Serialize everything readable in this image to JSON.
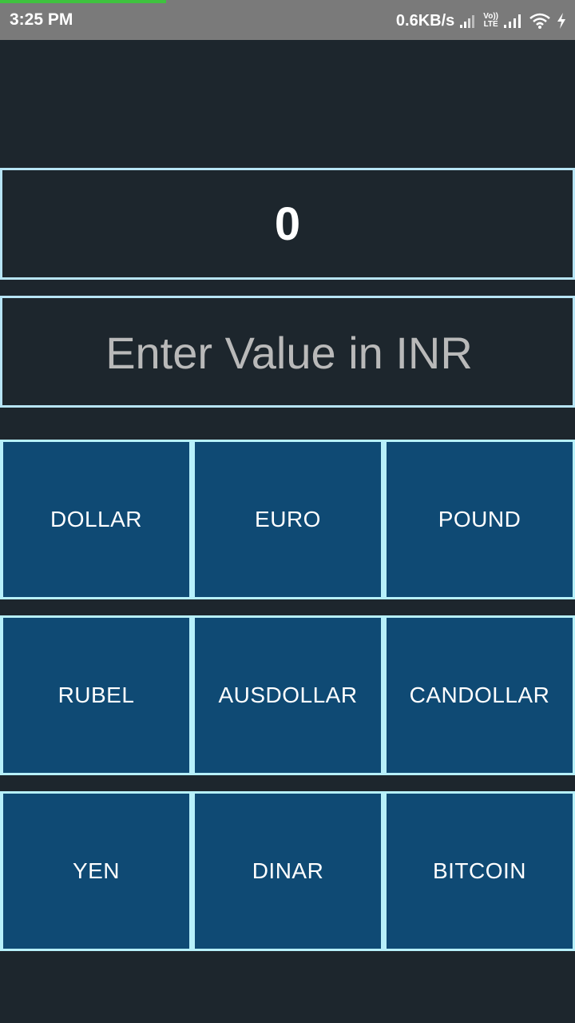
{
  "status_bar": {
    "time": "3:25 PM",
    "network_speed": "0.6KB/s",
    "volte_top": "Vo))",
    "volte_bottom": "LTE",
    "icons": [
      "signal-icon",
      "volte-icon",
      "signal-icon",
      "wifi-icon",
      "charging-icon"
    ]
  },
  "result": {
    "value": "0"
  },
  "input": {
    "placeholder": "Enter Value in INR",
    "value": ""
  },
  "buttons": {
    "row1": [
      "DOLLAR",
      "EURO",
      "POUND"
    ],
    "row2": [
      "RUBEL",
      "AUSDOLLAR",
      "CANDOLLAR"
    ],
    "row3": [
      "YEN",
      "DINAR",
      "BITCOIN"
    ]
  },
  "colors": {
    "background": "#1d262d",
    "button": "#0f4a74",
    "border": "#b7e4f4",
    "status_bar": "#7a7a7a"
  }
}
